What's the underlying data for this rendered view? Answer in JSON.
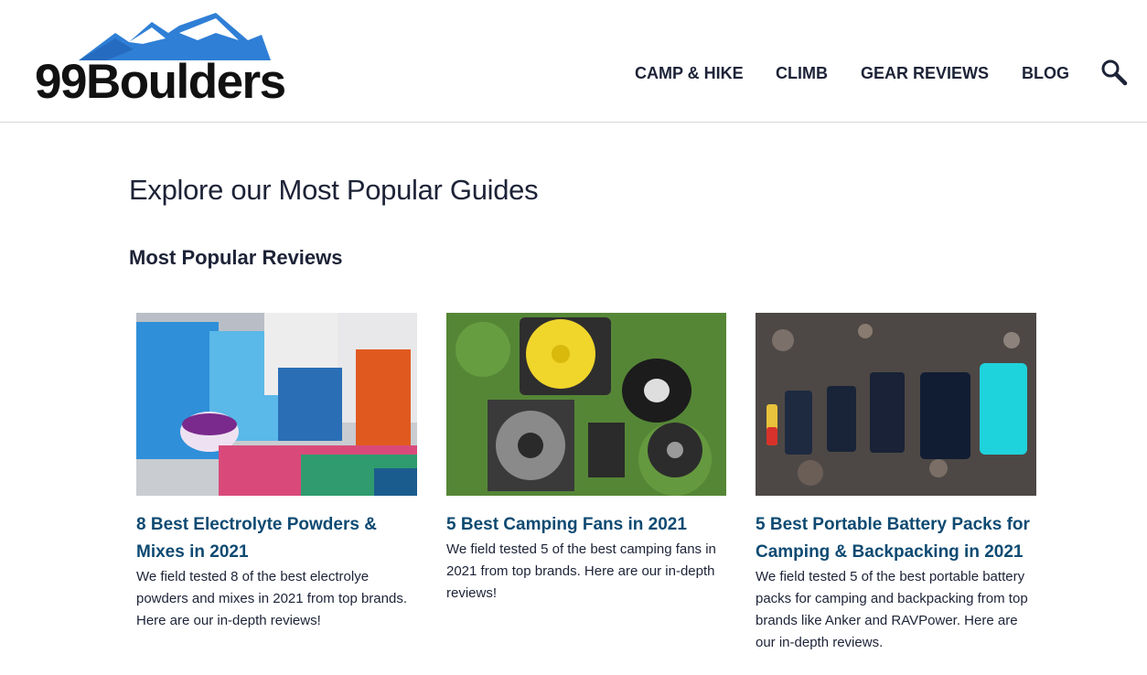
{
  "header": {
    "logo_text": "99Boulders",
    "nav": [
      {
        "label": "CAMP & HIKE"
      },
      {
        "label": "CLIMB"
      },
      {
        "label": "GEAR REVIEWS"
      },
      {
        "label": "BLOG"
      }
    ],
    "search_icon": "search-icon"
  },
  "main": {
    "title": "Explore our Most Popular Guides",
    "subtitle": "Most Popular Reviews",
    "cards": [
      {
        "title": "8 Best Electrolyte Powders & Mixes in 2021",
        "description": "We field tested 8 of the best electrolye powders and mixes in 2021 from top brands. Here are our in-depth reviews!",
        "image_subject": "electrolyte-products-photo"
      },
      {
        "title": "5 Best Camping Fans in 2021",
        "description": "We field tested 5 of the best camping fans in 2021 from top brands. Here are our in-depth reviews!",
        "image_subject": "camping-fans-photo"
      },
      {
        "title": "5 Best Portable Battery Packs for Camping & Backpacking in 2021",
        "description": "We field tested 5 of the best portable battery packs for camping and backpacking from top brands like Anker and RAVPower. Here are our in-depth reviews.",
        "image_subject": "battery-packs-photo"
      }
    ]
  },
  "colors": {
    "text_dark": "#1d2337",
    "link_blue": "#0e4a72",
    "logo_mountain": "#2f7fd6"
  }
}
